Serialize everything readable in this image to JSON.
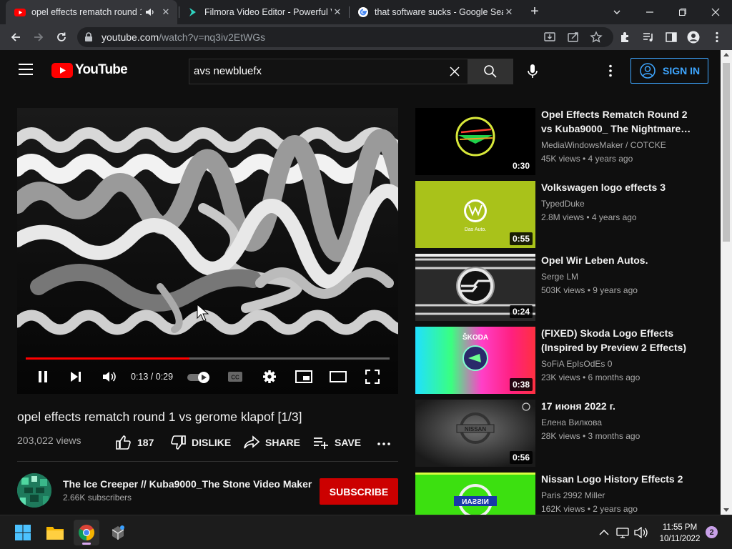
{
  "browser": {
    "tabs": [
      {
        "title": "opel effects rematch round 1",
        "favicon": "youtube-icon",
        "audio": true
      },
      {
        "title": "Filmora Video Editor - Powerful V",
        "favicon": "filmora-icon"
      },
      {
        "title": "that software sucks - Google Sea",
        "favicon": "google-icon"
      }
    ],
    "url_host": "youtube.com",
    "url_path": "/watch?v=nq3iv2EtWGs"
  },
  "header": {
    "logo_text": "YouTube",
    "search_value": "avs newbluefx",
    "signin_label": "SIGN IN",
    "accent": "#3ea6ff"
  },
  "player": {
    "time": "0:13 / 0:29",
    "progress": 0.45,
    "progress_color": "#ff0000",
    "autoplay_on": true
  },
  "video": {
    "title": "opel effects rematch round 1 vs gerome klapof [1/3]",
    "views": "203,022 views",
    "likes": "187",
    "dislike_label": "DISLIKE",
    "share_label": "SHARE",
    "save_label": "SAVE"
  },
  "channel": {
    "name": "The Ice Creeper // Kuba9000_The Stone Video Maker",
    "subscribers": "2.66K subscribers",
    "subscribe_label": "SUBSCRIBE",
    "subscribe_color": "#cc0000"
  },
  "recommendations": [
    {
      "title": "Opel Effects Rematch Round 2 vs Kuba9000_ The Nightmare…",
      "channel": "MediaWindowsMaker / COTCKE",
      "stats": "45K views • 4 years ago",
      "duration": "0:30",
      "thumb": "green-yellow-opel-logo-on-black"
    },
    {
      "title": "Volkswagen logo effects 3",
      "channel": "TypedDuke",
      "stats": "2.8M views • 4 years ago",
      "duration": "0:55",
      "thumb": "vw-logo-on-lime",
      "thumb_caption": "Das Auto."
    },
    {
      "title": "Opel Wir Leben Autos.",
      "channel": "Serge LM",
      "stats": "503K views • 9 years ago",
      "duration": "0:24",
      "thumb": "opel-grille-chrome"
    },
    {
      "title": "(FIXED) Skoda Logo Effects (Inspired by Preview 2 Effects)",
      "channel": "SoFiA EpIsOdEs 0",
      "stats": "23K views • 6 months ago",
      "duration": "0:38",
      "thumb": "skoda-rainbow-gradient",
      "thumb_caption": "ŠKODA"
    },
    {
      "title": "17 июня 2022 г.",
      "channel": "Елена Вилкова",
      "stats": "28K views • 3 months ago",
      "duration": "0:56",
      "thumb": "nissan-logo-grey",
      "thumb_caption": "NISSAN"
    },
    {
      "title": "Nissan Logo History Effects 2",
      "channel": "Paris 2992 Miller",
      "stats": "162K views • 2 years ago",
      "duration": "",
      "thumb": "nissan-logo-inverted-green",
      "thumb_caption": "NISSAN"
    }
  ],
  "taskbar": {
    "clock_time": "11:55 PM",
    "clock_date": "10/11/2022",
    "notifications": "2"
  }
}
